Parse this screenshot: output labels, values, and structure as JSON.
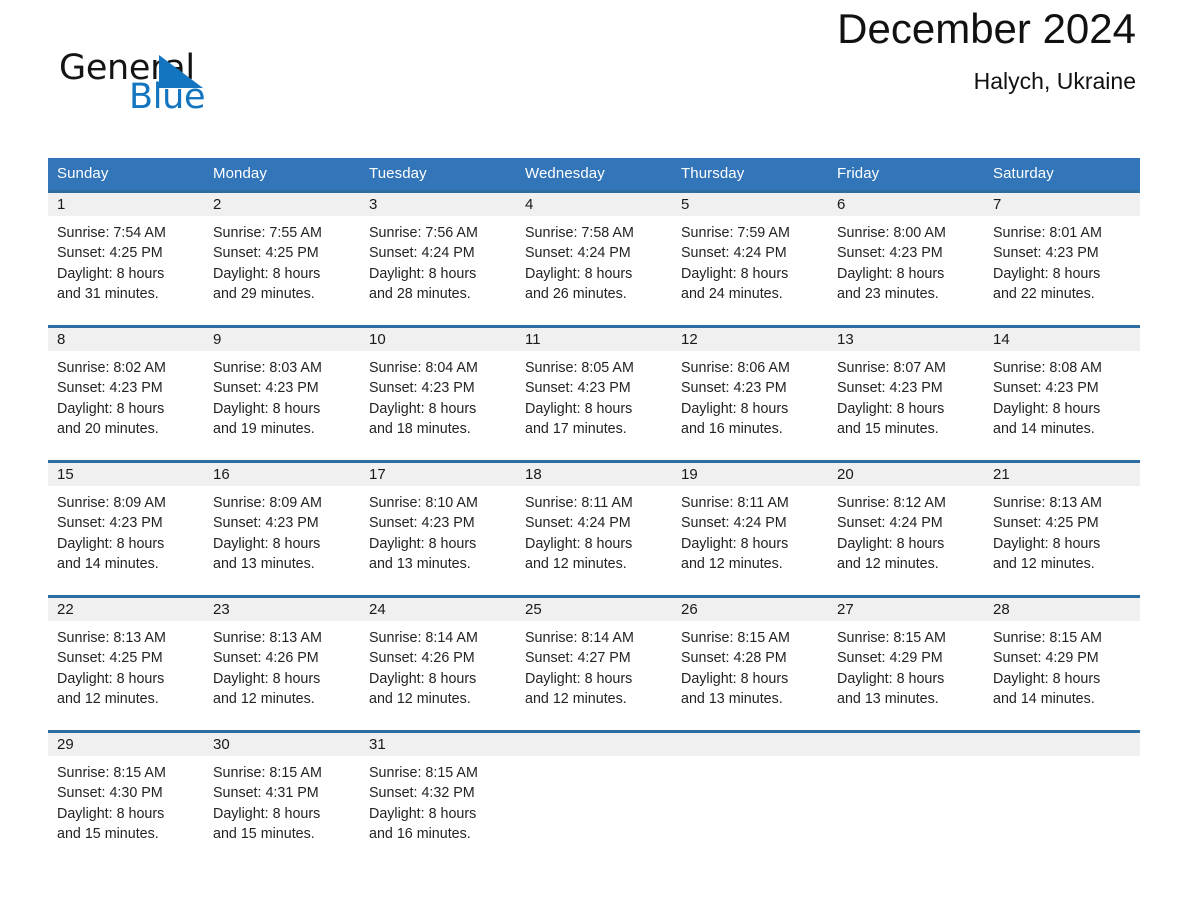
{
  "brand": {
    "name_part1": "General",
    "name_part2": "Blue",
    "logo_icon": "triangle-logo-icon",
    "accent_color": "#1375c0"
  },
  "header": {
    "month_title": "December 2024",
    "location": "Halych, Ukraine"
  },
  "theme": {
    "header_bg": "#3275b8",
    "row_border": "#2e6da4",
    "daynum_bg": "#f0f0f0",
    "text": "#232323"
  },
  "calendar": {
    "weekday_headers": [
      "Sunday",
      "Monday",
      "Tuesday",
      "Wednesday",
      "Thursday",
      "Friday",
      "Saturday"
    ],
    "weeks": [
      [
        {
          "day": "1",
          "sunrise": "Sunrise: 7:54 AM",
          "sunset": "Sunset: 4:25 PM",
          "daylight_line1": "Daylight: 8 hours",
          "daylight_line2": "and 31 minutes."
        },
        {
          "day": "2",
          "sunrise": "Sunrise: 7:55 AM",
          "sunset": "Sunset: 4:25 PM",
          "daylight_line1": "Daylight: 8 hours",
          "daylight_line2": "and 29 minutes."
        },
        {
          "day": "3",
          "sunrise": "Sunrise: 7:56 AM",
          "sunset": "Sunset: 4:24 PM",
          "daylight_line1": "Daylight: 8 hours",
          "daylight_line2": "and 28 minutes."
        },
        {
          "day": "4",
          "sunrise": "Sunrise: 7:58 AM",
          "sunset": "Sunset: 4:24 PM",
          "daylight_line1": "Daylight: 8 hours",
          "daylight_line2": "and 26 minutes."
        },
        {
          "day": "5",
          "sunrise": "Sunrise: 7:59 AM",
          "sunset": "Sunset: 4:24 PM",
          "daylight_line1": "Daylight: 8 hours",
          "daylight_line2": "and 24 minutes."
        },
        {
          "day": "6",
          "sunrise": "Sunrise: 8:00 AM",
          "sunset": "Sunset: 4:23 PM",
          "daylight_line1": "Daylight: 8 hours",
          "daylight_line2": "and 23 minutes."
        },
        {
          "day": "7",
          "sunrise": "Sunrise: 8:01 AM",
          "sunset": "Sunset: 4:23 PM",
          "daylight_line1": "Daylight: 8 hours",
          "daylight_line2": "and 22 minutes."
        }
      ],
      [
        {
          "day": "8",
          "sunrise": "Sunrise: 8:02 AM",
          "sunset": "Sunset: 4:23 PM",
          "daylight_line1": "Daylight: 8 hours",
          "daylight_line2": "and 20 minutes."
        },
        {
          "day": "9",
          "sunrise": "Sunrise: 8:03 AM",
          "sunset": "Sunset: 4:23 PM",
          "daylight_line1": "Daylight: 8 hours",
          "daylight_line2": "and 19 minutes."
        },
        {
          "day": "10",
          "sunrise": "Sunrise: 8:04 AM",
          "sunset": "Sunset: 4:23 PM",
          "daylight_line1": "Daylight: 8 hours",
          "daylight_line2": "and 18 minutes."
        },
        {
          "day": "11",
          "sunrise": "Sunrise: 8:05 AM",
          "sunset": "Sunset: 4:23 PM",
          "daylight_line1": "Daylight: 8 hours",
          "daylight_line2": "and 17 minutes."
        },
        {
          "day": "12",
          "sunrise": "Sunrise: 8:06 AM",
          "sunset": "Sunset: 4:23 PM",
          "daylight_line1": "Daylight: 8 hours",
          "daylight_line2": "and 16 minutes."
        },
        {
          "day": "13",
          "sunrise": "Sunrise: 8:07 AM",
          "sunset": "Sunset: 4:23 PM",
          "daylight_line1": "Daylight: 8 hours",
          "daylight_line2": "and 15 minutes."
        },
        {
          "day": "14",
          "sunrise": "Sunrise: 8:08 AM",
          "sunset": "Sunset: 4:23 PM",
          "daylight_line1": "Daylight: 8 hours",
          "daylight_line2": "and 14 minutes."
        }
      ],
      [
        {
          "day": "15",
          "sunrise": "Sunrise: 8:09 AM",
          "sunset": "Sunset: 4:23 PM",
          "daylight_line1": "Daylight: 8 hours",
          "daylight_line2": "and 14 minutes."
        },
        {
          "day": "16",
          "sunrise": "Sunrise: 8:09 AM",
          "sunset": "Sunset: 4:23 PM",
          "daylight_line1": "Daylight: 8 hours",
          "daylight_line2": "and 13 minutes."
        },
        {
          "day": "17",
          "sunrise": "Sunrise: 8:10 AM",
          "sunset": "Sunset: 4:23 PM",
          "daylight_line1": "Daylight: 8 hours",
          "daylight_line2": "and 13 minutes."
        },
        {
          "day": "18",
          "sunrise": "Sunrise: 8:11 AM",
          "sunset": "Sunset: 4:24 PM",
          "daylight_line1": "Daylight: 8 hours",
          "daylight_line2": "and 12 minutes."
        },
        {
          "day": "19",
          "sunrise": "Sunrise: 8:11 AM",
          "sunset": "Sunset: 4:24 PM",
          "daylight_line1": "Daylight: 8 hours",
          "daylight_line2": "and 12 minutes."
        },
        {
          "day": "20",
          "sunrise": "Sunrise: 8:12 AM",
          "sunset": "Sunset: 4:24 PM",
          "daylight_line1": "Daylight: 8 hours",
          "daylight_line2": "and 12 minutes."
        },
        {
          "day": "21",
          "sunrise": "Sunrise: 8:13 AM",
          "sunset": "Sunset: 4:25 PM",
          "daylight_line1": "Daylight: 8 hours",
          "daylight_line2": "and 12 minutes."
        }
      ],
      [
        {
          "day": "22",
          "sunrise": "Sunrise: 8:13 AM",
          "sunset": "Sunset: 4:25 PM",
          "daylight_line1": "Daylight: 8 hours",
          "daylight_line2": "and 12 minutes."
        },
        {
          "day": "23",
          "sunrise": "Sunrise: 8:13 AM",
          "sunset": "Sunset: 4:26 PM",
          "daylight_line1": "Daylight: 8 hours",
          "daylight_line2": "and 12 minutes."
        },
        {
          "day": "24",
          "sunrise": "Sunrise: 8:14 AM",
          "sunset": "Sunset: 4:26 PM",
          "daylight_line1": "Daylight: 8 hours",
          "daylight_line2": "and 12 minutes."
        },
        {
          "day": "25",
          "sunrise": "Sunrise: 8:14 AM",
          "sunset": "Sunset: 4:27 PM",
          "daylight_line1": "Daylight: 8 hours",
          "daylight_line2": "and 12 minutes."
        },
        {
          "day": "26",
          "sunrise": "Sunrise: 8:15 AM",
          "sunset": "Sunset: 4:28 PM",
          "daylight_line1": "Daylight: 8 hours",
          "daylight_line2": "and 13 minutes."
        },
        {
          "day": "27",
          "sunrise": "Sunrise: 8:15 AM",
          "sunset": "Sunset: 4:29 PM",
          "daylight_line1": "Daylight: 8 hours",
          "daylight_line2": "and 13 minutes."
        },
        {
          "day": "28",
          "sunrise": "Sunrise: 8:15 AM",
          "sunset": "Sunset: 4:29 PM",
          "daylight_line1": "Daylight: 8 hours",
          "daylight_line2": "and 14 minutes."
        }
      ],
      [
        {
          "day": "29",
          "sunrise": "Sunrise: 8:15 AM",
          "sunset": "Sunset: 4:30 PM",
          "daylight_line1": "Daylight: 8 hours",
          "daylight_line2": "and 15 minutes."
        },
        {
          "day": "30",
          "sunrise": "Sunrise: 8:15 AM",
          "sunset": "Sunset: 4:31 PM",
          "daylight_line1": "Daylight: 8 hours",
          "daylight_line2": "and 15 minutes."
        },
        {
          "day": "31",
          "sunrise": "Sunrise: 8:15 AM",
          "sunset": "Sunset: 4:32 PM",
          "daylight_line1": "Daylight: 8 hours",
          "daylight_line2": "and 16 minutes."
        },
        {
          "day": "",
          "sunrise": "",
          "sunset": "",
          "daylight_line1": "",
          "daylight_line2": ""
        },
        {
          "day": "",
          "sunrise": "",
          "sunset": "",
          "daylight_line1": "",
          "daylight_line2": ""
        },
        {
          "day": "",
          "sunrise": "",
          "sunset": "",
          "daylight_line1": "",
          "daylight_line2": ""
        },
        {
          "day": "",
          "sunrise": "",
          "sunset": "",
          "daylight_line1": "",
          "daylight_line2": ""
        }
      ]
    ]
  }
}
